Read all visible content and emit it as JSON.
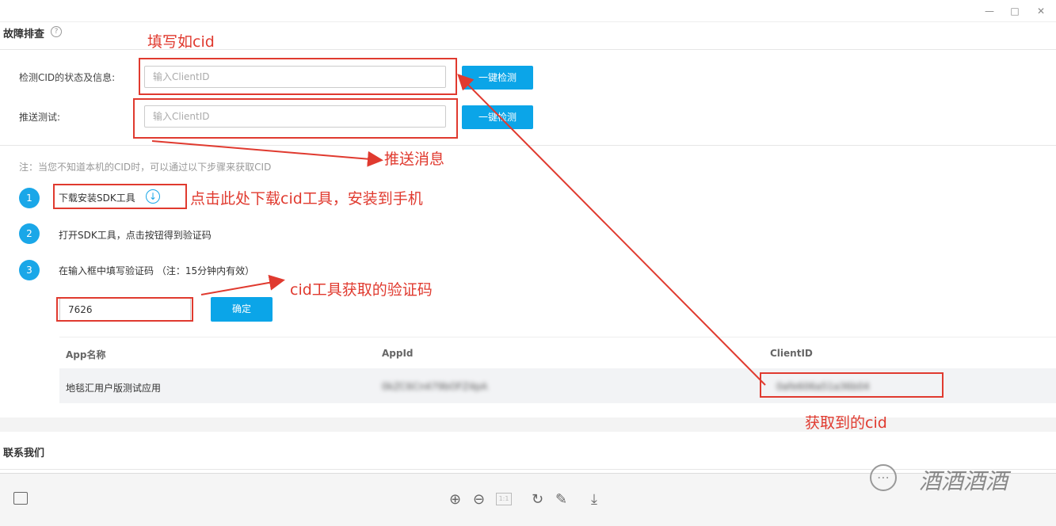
{
  "window": {
    "minimize_icon": "minimize-icon",
    "maximize_icon": "maximize-icon",
    "close_icon": "close-icon"
  },
  "section": {
    "title": "故障排查",
    "help_icon": "?"
  },
  "form": {
    "cid_status_label": "检测CID的状态及信息:",
    "push_test_label": "推送测试:",
    "placeholder": "输入ClientID",
    "check_button": "一键检测",
    "push_button": "一键检测"
  },
  "note": "注：当您不知道本机的CID时，可以通过以下步骤来获取CID",
  "steps": [
    {
      "num": "1",
      "text": "下载安装SDK工具"
    },
    {
      "num": "2",
      "text": "打开SDK工具，点击按钮得到验证码"
    },
    {
      "num": "3",
      "text": "在输入框中填写验证码 （注：15分钟内有效）"
    }
  ],
  "code_input": "7626",
  "confirm_button": "确定",
  "table": {
    "headers": [
      "App名称",
      "AppId",
      "ClientID"
    ],
    "row": {
      "app_name": "地毯汇用户版测试应用",
      "app_id": "0kZC6Cn479bOFZ4pA",
      "client_id": "0afe606a51a36b04"
    }
  },
  "contact": "联系我们",
  "annotations": {
    "fill_cid": "填写如cid",
    "push_msg": "推送消息",
    "download_tip": "点击此处下载cid工具，安装到手机",
    "code_tip": "cid工具获取的验证码",
    "got_cid": "获取到的cid"
  },
  "watermark": "酒酒酒酒",
  "colors": {
    "accent": "#0ba5e8",
    "annotation": "#e03a2f"
  }
}
